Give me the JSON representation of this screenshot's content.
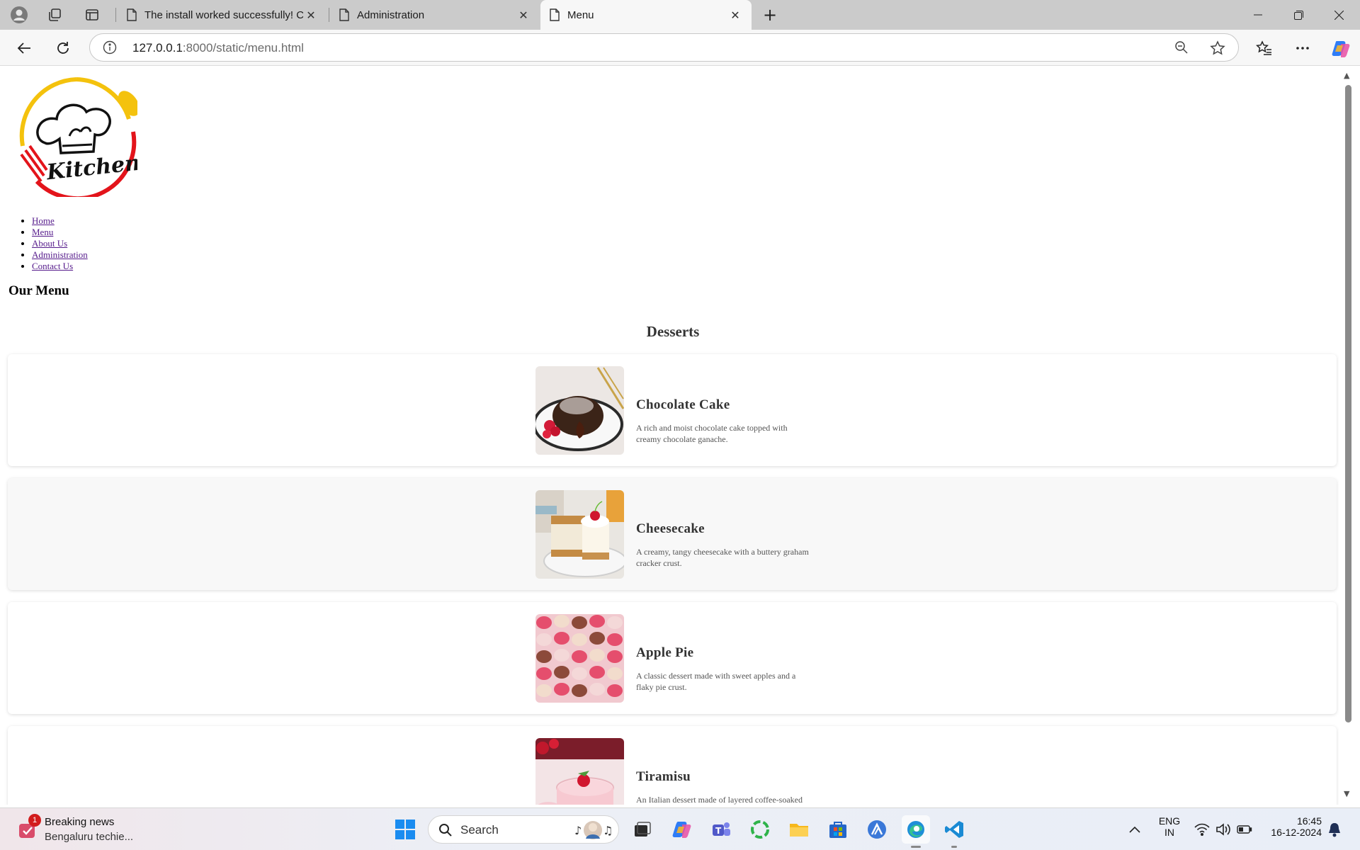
{
  "browser": {
    "tabs": [
      {
        "title": "The install worked successfully! Congratulations!",
        "active": false
      },
      {
        "title": "Administration",
        "active": false
      },
      {
        "title": "Menu",
        "active": true
      }
    ],
    "address": {
      "host": "127.0.0.1",
      "path": ":8000/static/menu.html"
    }
  },
  "page": {
    "logo_text": "Kitchen",
    "nav": [
      "Home",
      "Menu",
      "About Us",
      "Administration",
      "Contact Us"
    ],
    "title": "Our Menu",
    "section": "Desserts",
    "items": [
      {
        "name": "Chocolate Cake",
        "desc": "A rich and moist chocolate cake topped with creamy chocolate ganache."
      },
      {
        "name": "Cheesecake",
        "desc": "A creamy, tangy cheesecake with a buttery graham cracker crust."
      },
      {
        "name": "Apple Pie",
        "desc": "A classic dessert made with sweet apples and a flaky pie crust."
      },
      {
        "name": "Tiramisu",
        "desc": "An Italian dessert made of layered coffee-soaked ladyfingers and mascarpone cream."
      }
    ]
  },
  "taskbar": {
    "news": {
      "badge": "1",
      "title": "Breaking news",
      "subtitle": "Bengaluru techie..."
    },
    "search_label": "Search",
    "lang": {
      "line1": "ENG",
      "line2": "IN"
    },
    "time": "16:45",
    "date": "16-12-2024"
  },
  "colors": {
    "accent_red": "#e3141b",
    "accent_yellow": "#f4c20d",
    "link": "#551a8b"
  }
}
